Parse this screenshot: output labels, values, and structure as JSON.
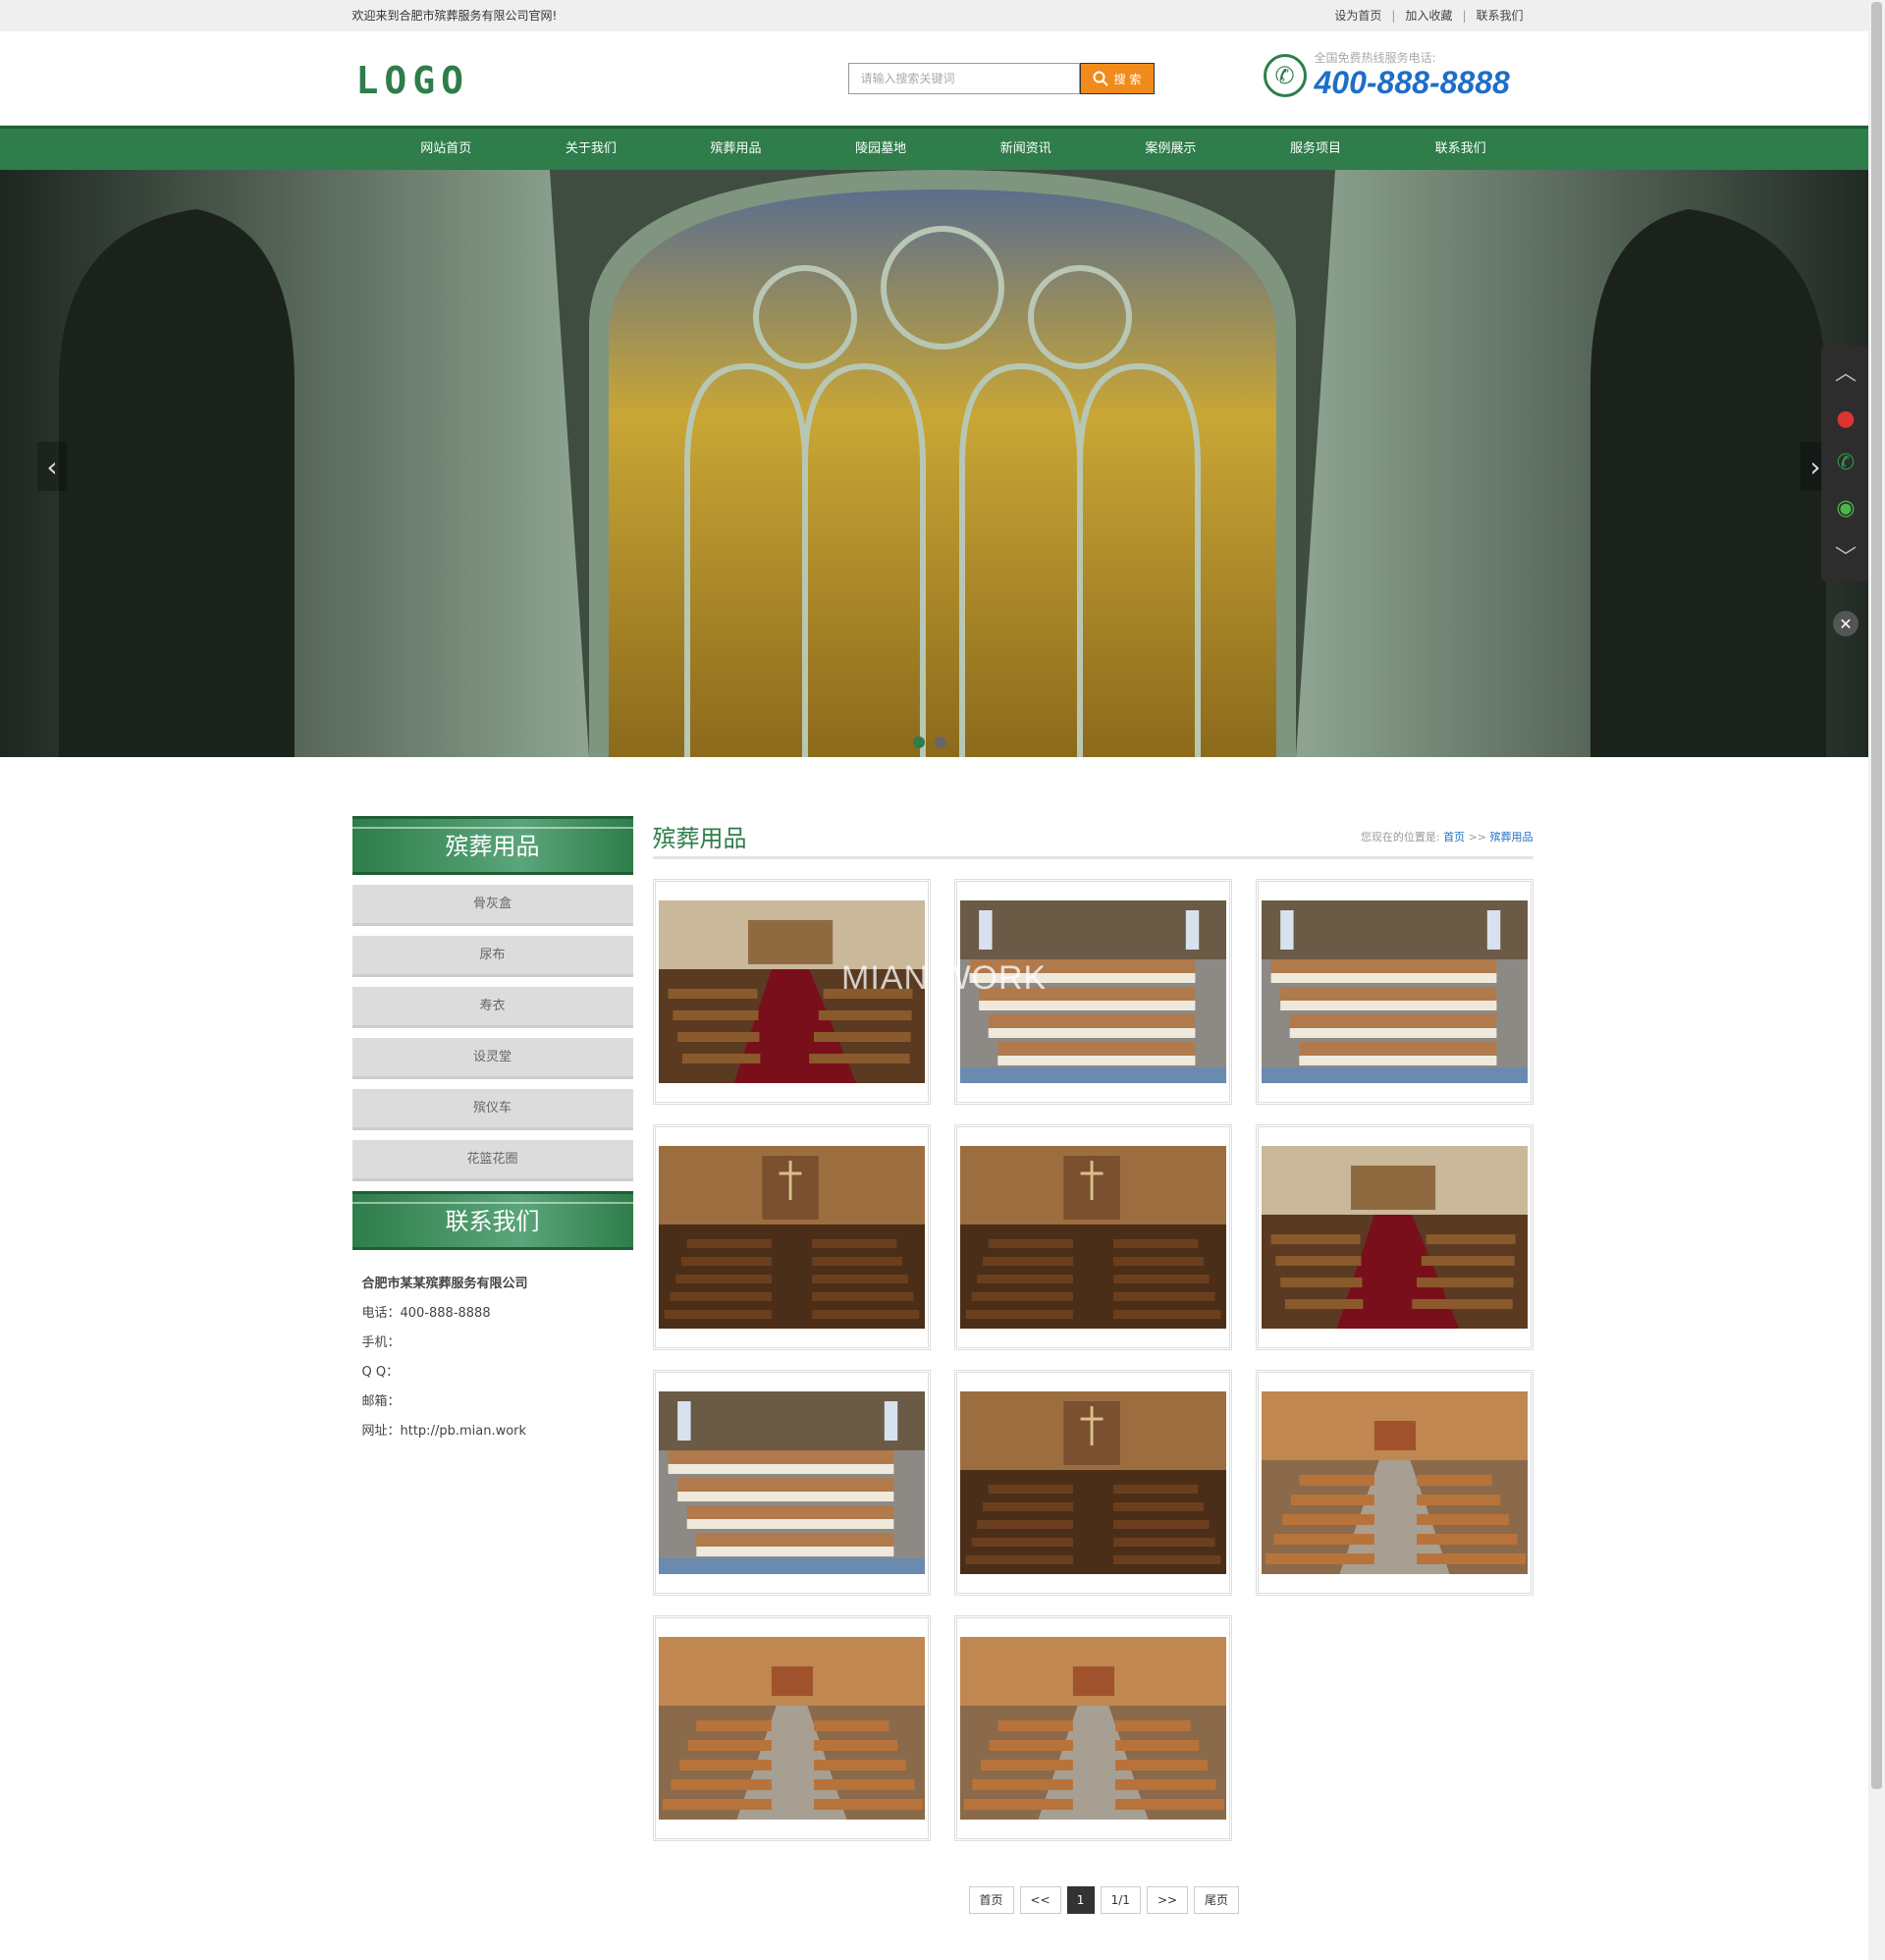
{
  "topbar": {
    "welcome": "欢迎来到合肥市殡葬服务有限公司官网!",
    "links": [
      "设为首页",
      "加入收藏",
      "联系我们"
    ]
  },
  "header": {
    "logo": "LOGO",
    "search_placeholder": "请输入搜索关键词",
    "search_button": "搜 索",
    "hotline_label": "全国免费热线服务电话:",
    "hotline": "400-888-8888"
  },
  "nav": [
    "网站首页",
    "关于我们",
    "殡葬用品",
    "陵园墓地",
    "新闻资讯",
    "案例展示",
    "服务项目",
    "联系我们"
  ],
  "banner": {
    "prev": "‹",
    "next": "›",
    "dots": 2,
    "active_dot": 0
  },
  "float": {
    "icons": [
      "up-icon",
      "qq-icon",
      "phone-icon",
      "wechat-icon",
      "down-icon"
    ],
    "close": "✕"
  },
  "sidebar": {
    "title": "殡葬用品",
    "categories": [
      "骨灰盒",
      "尿布",
      "寿衣",
      "设灵堂",
      "殡仪车",
      "花篮花圈"
    ],
    "contact_title": "联系我们",
    "company": "合肥市某某殡葬服务有限公司",
    "contact_lines": [
      "电话：400-888-8888",
      "手机：",
      "Q Q：",
      "邮箱：",
      "网址：http://pb.mian.work"
    ]
  },
  "content": {
    "title": "殡葬用品",
    "crumb_prefix": "您现在的位置是:",
    "crumb_home": "首页",
    "crumb_sep": ">>",
    "crumb_current": "殡葬用品",
    "items": [
      "chapel-red-aisle",
      "pews-light",
      "pews-light",
      "chapel-wood",
      "chapel-wood",
      "chapel-red-aisle",
      "pews-light",
      "chapel-wood",
      "chapel-orange",
      "chapel-orange",
      "chapel-orange"
    ]
  },
  "watermark": "MIAN.WORK",
  "pager": [
    "首页",
    "<<",
    "1",
    "1/1",
    ">>",
    "尾页"
  ],
  "colors": {
    "brand": "#2e7d4a",
    "accent": "#f08b1c",
    "link": "#1e6ec8"
  }
}
